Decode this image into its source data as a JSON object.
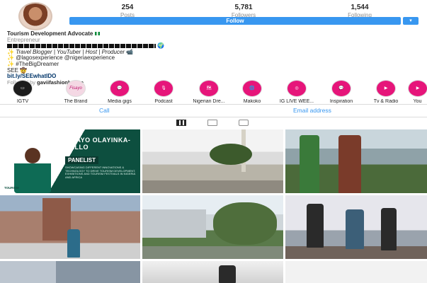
{
  "profile": {
    "stats": [
      {
        "value": "254",
        "label": "Posts"
      },
      {
        "value": "5,781",
        "label": "Followers"
      },
      {
        "value": "1,544",
        "label": "Following"
      }
    ],
    "follow_label": "Follow",
    "follow_more": "▾"
  },
  "bio": {
    "name": "Tourism Development Advocate",
    "category": "Entrepreneur",
    "line2": "Travel Blogger | YouTuber | Host | Producer",
    "line3": "@lagosexperience @nigeriaexperience",
    "line4": "#TheBigDreamer",
    "line5": "SEE",
    "link": "bit.ly/SEEwhatIDO",
    "followed_prefix": "Followed by ",
    "followed_by": "gaviifashionhouse"
  },
  "highlights": [
    {
      "label": "IGTV",
      "badge": "▭"
    },
    {
      "label": "The Brand",
      "badge": "Fisayo"
    },
    {
      "label": "Media gigs",
      "badge": "💬"
    },
    {
      "label": "Podcast",
      "badge": "🎙"
    },
    {
      "label": "Nigerian Dre...",
      "badge": "🗺"
    },
    {
      "label": "Makoko",
      "badge": "🌐"
    },
    {
      "label": "IG LIVE WEE...",
      "badge": "◎"
    },
    {
      "label": "Inspiration",
      "badge": "💬"
    },
    {
      "label": "Tv & Radio",
      "badge": "▶"
    },
    {
      "label": "You",
      "badge": "▶"
    }
  ],
  "contact": {
    "call": "Call",
    "email": "Email address"
  },
  "posts": {
    "poster_name": "FISAYO OLAYINKA-BELLO",
    "poster_pill": "PANELIST",
    "poster_body": "SHOWCASING DIFFERENT INNOVATIONS & TECHNOLOGY TO DRIVE TOURISM DEVELOPMENT, EXHIBITIONS AND TOURISM FESTIVALS IN NIGERIA AND AFRICA",
    "poster_foot": "TOURISM"
  },
  "colors": {
    "accent": "#3897f0",
    "highlight_pink": "#e6157a",
    "poster_green": "#0d4f3f"
  }
}
